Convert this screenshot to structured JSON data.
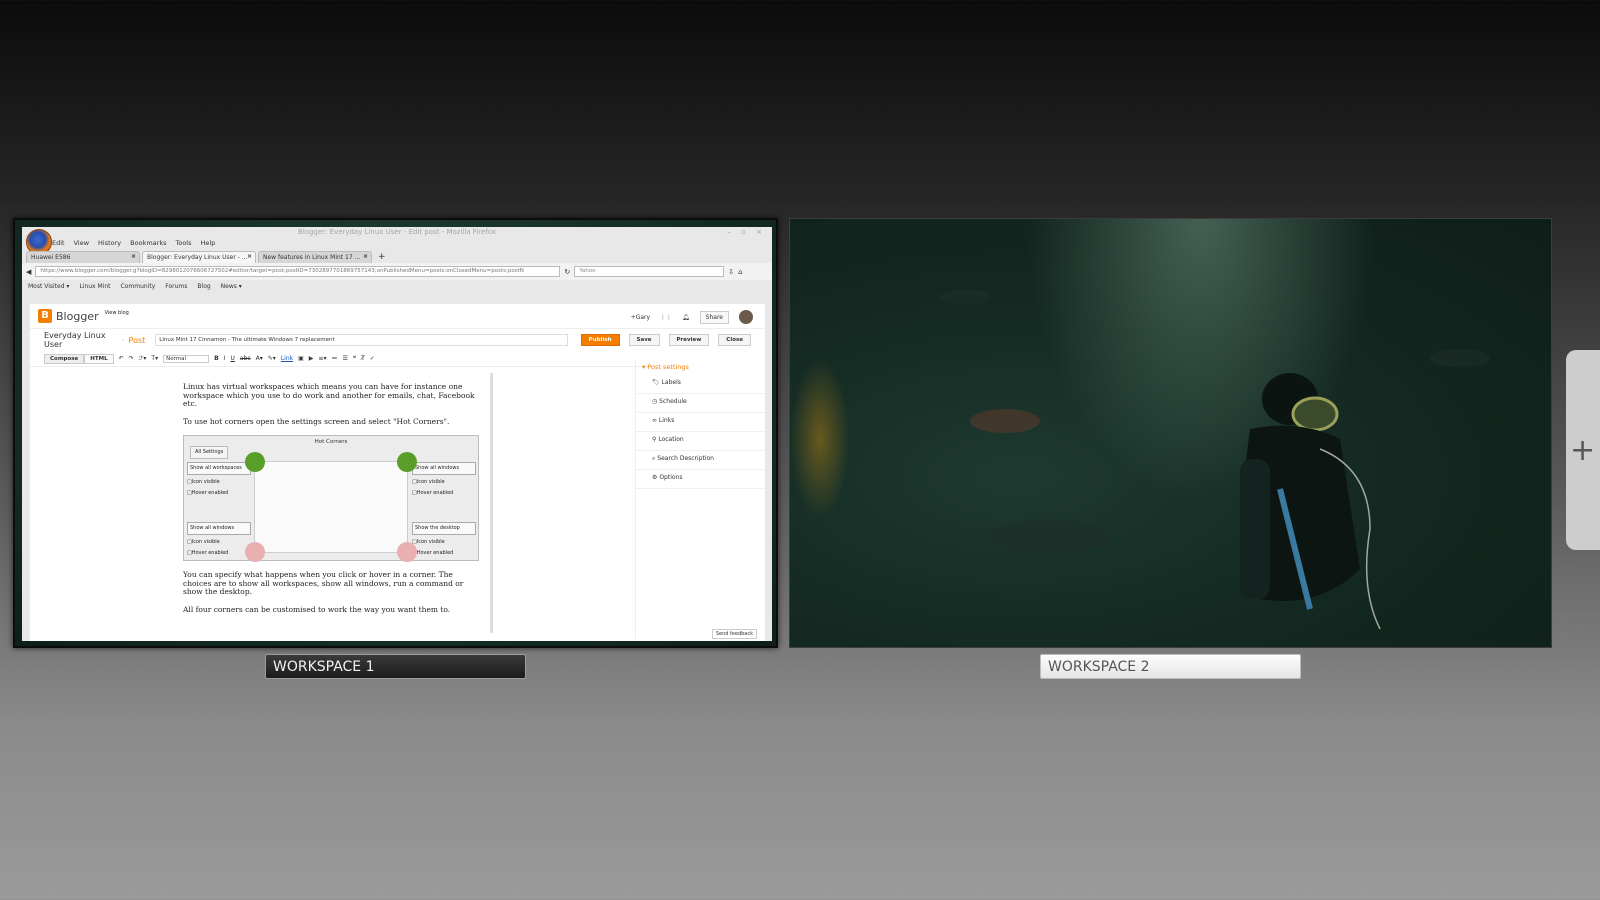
{
  "workspaces": [
    {
      "label": "WORKSPACE 1",
      "active": true
    },
    {
      "label": "WORKSPACE 2",
      "active": false
    }
  ],
  "add_workspace_icon": "plus-icon",
  "firefox": {
    "title": "Blogger: Everyday Linux User - Edit post - Mozilla Firefox",
    "menu": [
      "Edit",
      "View",
      "History",
      "Bookmarks",
      "Tools",
      "Help"
    ],
    "tabs": [
      {
        "label": "Huawei E586",
        "active": false
      },
      {
        "label": "Blogger: Everyday Linux User - ...",
        "active": true
      },
      {
        "label": "New features in Linux Mint 17 ...",
        "active": false
      }
    ],
    "url": "https://www.blogger.com/blogger.g?blogID=8298012076606727502#editor/target=post;postID=7302897701869757143;onPublishedMenu=posts;onClosedMenu=posts;postN",
    "search_placeholder": "Yahoo",
    "bookmarks": [
      "Most Visited ▾",
      "Linux Mint",
      "Community",
      "Forums",
      "Blog",
      "News ▾"
    ]
  },
  "blogger": {
    "logo_text": "Blogger",
    "view_blog": "View blog",
    "user": "+Gary",
    "share": "Share",
    "blog_name": "Everyday Linux User",
    "separator": "·",
    "post_label": "Post",
    "post_title": "Linux Mint 17 Cinnamon - The ultimate Windows 7 replacement",
    "buttons": {
      "publish": "Publish",
      "save": "Save",
      "preview": "Preview",
      "close": "Close"
    },
    "compose": "Compose",
    "html": "HTML",
    "format": "Normal",
    "link": "Link",
    "paragraphs": [
      "Linux has virtual workspaces which means you can have for instance one workspace which you use to do work and another for emails, chat, Facebook etc.",
      "To use hot corners open the settings screen and select \"Hot Corners\".",
      "You can specify what happens when you click or hover in a corner. The choices are to show all workspaces, show all windows, run a command or show the desktop.",
      "All four corners can be customised to work the way you want them to."
    ],
    "hot_corners": {
      "title": "Hot Corners",
      "all_settings": "All Settings",
      "top_left": "Show all workspaces",
      "top_right": "Show all windows",
      "bottom_left": "Show all windows",
      "bottom_right": "Show the desktop",
      "icon_visible": "Icon visible",
      "hover_enabled": "Hover enabled"
    },
    "sidebar": {
      "header": "Post settings",
      "items": [
        "Labels",
        "Schedule",
        "Links",
        "Location",
        "Search Description",
        "Options"
      ]
    },
    "send_feedback": "Send feedback"
  }
}
